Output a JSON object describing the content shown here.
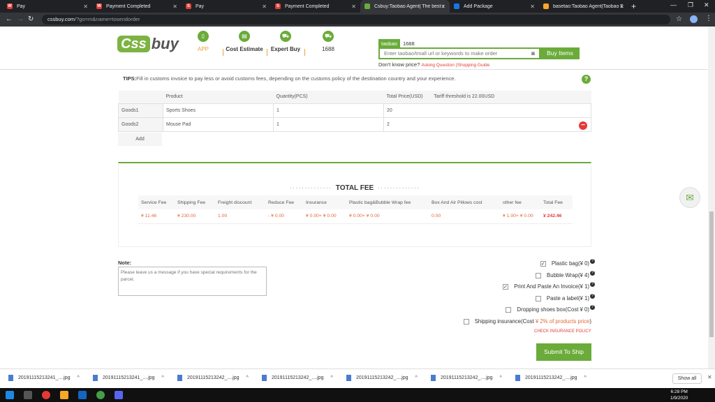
{
  "browser": {
    "tabs": [
      {
        "title": "Pay",
        "favicon": "w-icon",
        "color": "#e53935"
      },
      {
        "title": "Payment Completed",
        "favicon": "w-icon",
        "color": "#e53935"
      },
      {
        "title": "Pay",
        "favicon": "s-icon",
        "color": "#e53935"
      },
      {
        "title": "Payment Completed",
        "favicon": "s-icon",
        "color": "#e53935"
      },
      {
        "title": "Csbuy:Taobao Agent| The best c",
        "favicon": "cssbuy-icon",
        "color": "#6aab3a"
      },
      {
        "title": "Add Package",
        "favicon": "package-icon",
        "color": "#1a73e8"
      },
      {
        "title": "basetao:Taobao Agent|Taobao E",
        "favicon": "basetao-icon",
        "color": "#f9a825"
      }
    ],
    "url_host": "cssbuy.com",
    "url_path": "/?go=m&name=tosendorder"
  },
  "header": {
    "logo_css": "Css",
    "logo_buy": "buy",
    "nav": [
      {
        "label": "APP"
      },
      {
        "label": "Cost Estimate"
      },
      {
        "label": "Expert Buy"
      },
      {
        "label": "1688"
      }
    ],
    "search_tabs": [
      "taobao",
      "1688"
    ],
    "search_placeholder": "Enter taobao/tmall url or keywords to make order",
    "buy_button": "Buy Items",
    "price_question": "Don't know price?",
    "asking_question": "Asking Question",
    "shopping_guide": "Shopping Guide"
  },
  "tips": {
    "label": "TIPS:",
    "text": "Fill in customs invoice to pay less or avoid customs fees, depending on the customs policy of the destination country and your experience."
  },
  "goods_table": {
    "headers": [
      "Product",
      "Quantity(PCS)",
      "Total Price(USD)"
    ],
    "threshold": "Tariff threshold is 22.00USD",
    "rows": [
      {
        "label": "Goods1",
        "product": "Sports Shoes",
        "quantity": "1",
        "price": "20"
      },
      {
        "label": "Goods2",
        "product": "Mouse Pad",
        "quantity": "1",
        "price": "2"
      }
    ],
    "add_label": "Add"
  },
  "total_fee": {
    "title": "TOTAL FEE",
    "headers": [
      "Service Fee",
      "Shipping Fee",
      "Freight discount",
      "Reduce Fee",
      "Insurance",
      "Plastic bag&Bubble Wrap fee",
      "Box And Air Pillows cost",
      "other fee",
      "Total Fee"
    ],
    "values": [
      "¥ 11.46",
      "¥ 230.00",
      "1.00",
      "- ¥ 0.00",
      "¥ 0.00+ ¥ 0.00",
      "¥ 0.00+ ¥ 0.00",
      "0.00",
      "¥ 1.00+ ¥ 0.00",
      "¥ 242.46"
    ]
  },
  "note": {
    "label": "Note:",
    "placeholder": "Please leave us a message if you have special requirements for the parcel."
  },
  "options": [
    {
      "label": "Plastic bag(¥ 0)",
      "checked": true
    },
    {
      "label": "Bubble Wrap(¥ 4)",
      "checked": false
    },
    {
      "label": "Print And Paste An Invoice(¥ 1)",
      "checked": true
    },
    {
      "label": "Paste a label(¥ 1)",
      "checked": false
    },
    {
      "label": "Dropping shoes box(Cost ¥ 0)",
      "checked": false
    }
  ],
  "insurance": {
    "label_prefix": "Shipping insurance(Cost",
    "label_red": "¥ 2% of products price",
    "label_suffix": ")",
    "policy_link": "CHECK INSURANCE POLICY"
  },
  "submit_label": "Submit To Ship",
  "downloads": {
    "items": [
      "20191115213241_....jpg",
      "20191115213241_....jpg",
      "20191115213242_....jpg",
      "20191115213242_....jpg",
      "20191115213242_....jpg",
      "20191115213242_....jpg",
      "20191115213242_....jpg"
    ],
    "show_all": "Show all"
  },
  "taskbar": {
    "time": "6:28 PM",
    "date": "1/9/2020"
  },
  "colors": {
    "brand_green": "#6aab3a",
    "accent_red": "#e53935",
    "fee_orange": "#e06a3a"
  }
}
